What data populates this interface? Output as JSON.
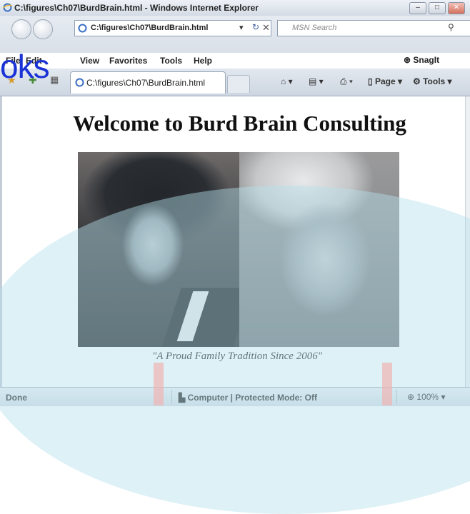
{
  "window": {
    "title": "C:\\figures\\Ch07\\BurdBrain.html - Windows Internet Explorer",
    "minimize": "–",
    "maximize": "□",
    "close": "✕"
  },
  "address_bar": {
    "url": "C:\\figures\\Ch07\\BurdBrain.html",
    "search_placeholder": "MSN Search"
  },
  "menu": {
    "items": [
      "File",
      "Edit",
      "View",
      "Favorites",
      "Tools",
      "Help"
    ],
    "snagit": "SnagIt"
  },
  "tab": {
    "label": "C:\\figures\\Ch07\\BurdBrain.html"
  },
  "command_bar": {
    "page": "Page",
    "tools": "Tools"
  },
  "page": {
    "heading": "Welcome to Burd Brain Consulting",
    "caption": "\"A Proud Family Tradition Since 2006\""
  },
  "status": {
    "text": "Done",
    "zone": "Computer | Protected Mode: Off",
    "zoom": "100%"
  },
  "watermark": {
    "text": "oks"
  },
  "colors": {
    "watermark_blue": "#1a33d6",
    "watermark_circle": "#b6e0ea"
  }
}
